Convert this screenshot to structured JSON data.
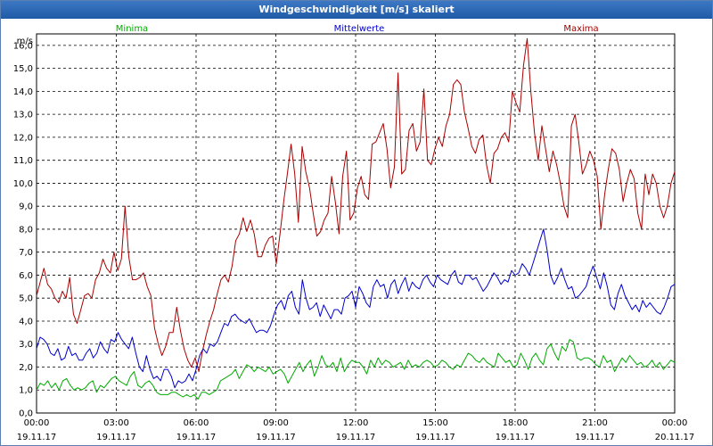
{
  "window": {
    "title": "Windgeschwindigkeit [m/s] skaliert"
  },
  "chart_data": {
    "type": "line",
    "title": "Windgeschwindigkeit [m/s] skaliert",
    "ylabel": "m/s",
    "ylim": [
      0,
      16.5
    ],
    "yticks": [
      0,
      1,
      2,
      3,
      4,
      5,
      6,
      7,
      8,
      9,
      10,
      11,
      12,
      13,
      14,
      15,
      16
    ],
    "ytick_labels": [
      "0,0",
      "1,0",
      "2,0",
      "3,0",
      "4,0",
      "5,0",
      "6,0",
      "7,0",
      "8,0",
      "9,0",
      "10,0",
      "11,0",
      "12,0",
      "13,0",
      "14,0",
      "15,0",
      "16,0"
    ],
    "xlim": [
      0,
      24
    ],
    "xticks": [
      0,
      3,
      6,
      9,
      12,
      15,
      18,
      21,
      24
    ],
    "xtick_time_labels": [
      "00:00",
      "03:00",
      "06:00",
      "09:00",
      "12:00",
      "15:00",
      "18:00",
      "21:00",
      "00:00"
    ],
    "xtick_date_labels": [
      "19.11.17",
      "19.11.17",
      "19.11.17",
      "19.11.17",
      "19.11.17",
      "19.11.17",
      "19.11.17",
      "19.11.17",
      "20.11.17"
    ],
    "grid": true,
    "legend_position": "top",
    "x_step_hours": 0.1667,
    "series": [
      {
        "name": "Minima",
        "color": "#00aa00",
        "values": [
          1.0,
          1.3,
          1.2,
          1.4,
          1.1,
          1.3,
          1.0,
          1.4,
          1.5,
          1.2,
          1.0,
          1.1,
          1.0,
          1.1,
          1.3,
          1.4,
          0.9,
          1.2,
          1.1,
          1.3,
          1.5,
          1.6,
          1.4,
          1.3,
          1.2,
          1.6,
          1.8,
          1.2,
          1.1,
          1.3,
          1.4,
          1.2,
          0.9,
          0.8,
          0.8,
          0.8,
          0.9,
          0.9,
          0.8,
          0.7,
          0.8,
          0.7,
          0.8,
          0.6,
          0.9,
          0.9,
          0.8,
          0.9,
          1.0,
          1.4,
          1.5,
          1.6,
          1.7,
          1.9,
          1.5,
          1.8,
          2.1,
          2.0,
          1.8,
          2.0,
          1.9,
          1.8,
          2.0,
          1.7,
          1.8,
          1.9,
          1.7,
          1.3,
          1.6,
          1.9,
          2.2,
          1.8,
          2.1,
          2.3,
          1.6,
          2.0,
          2.5,
          2.1,
          2.0,
          2.2,
          1.8,
          2.4,
          1.8,
          2.1,
          2.3,
          2.2,
          2.2,
          2.0,
          1.7,
          2.3,
          2.0,
          2.4,
          2.1,
          2.3,
          2.2,
          2.0,
          2.1,
          2.2,
          1.9,
          2.3,
          2.0,
          2.1,
          2.0,
          2.2,
          2.3,
          2.2,
          2.0,
          2.1,
          2.3,
          2.2,
          2.0,
          1.9,
          2.1,
          2.0,
          2.3,
          2.6,
          2.5,
          2.3,
          2.2,
          2.4,
          2.2,
          2.1,
          2.0,
          2.6,
          2.4,
          2.2,
          2.3,
          2.0,
          2.1,
          2.6,
          2.3,
          1.9,
          2.4,
          2.6,
          2.3,
          2.1,
          2.8,
          3.0,
          2.6,
          2.3,
          2.9,
          2.7,
          3.2,
          3.1,
          2.4,
          2.3,
          2.4,
          2.4,
          2.3,
          2.1,
          2.0,
          2.5,
          2.2,
          2.3,
          1.8,
          2.1,
          2.4,
          2.2,
          2.5,
          2.3,
          2.1,
          2.2,
          2.0,
          2.1,
          2.3,
          2.0,
          2.2,
          1.9,
          2.1,
          2.3,
          2.2
        ]
      },
      {
        "name": "Mittelwerte",
        "color": "#0000cc",
        "values": [
          2.8,
          3.3,
          3.2,
          3.0,
          2.6,
          2.5,
          2.8,
          2.3,
          2.4,
          2.9,
          2.5,
          2.6,
          2.3,
          2.3,
          2.6,
          2.8,
          2.4,
          2.6,
          3.1,
          2.8,
          2.6,
          3.2,
          3.1,
          3.5,
          3.2,
          3.0,
          2.8,
          3.3,
          2.6,
          2.0,
          1.8,
          2.5,
          1.9,
          1.5,
          1.6,
          1.4,
          1.9,
          1.9,
          1.6,
          1.1,
          1.4,
          1.3,
          1.4,
          1.7,
          1.4,
          1.9,
          2.5,
          2.8,
          2.6,
          3.0,
          2.9,
          3.1,
          3.5,
          3.9,
          3.8,
          4.2,
          4.3,
          4.1,
          4.0,
          3.9,
          4.1,
          3.8,
          3.5,
          3.6,
          3.6,
          3.5,
          3.8,
          4.3,
          4.7,
          4.9,
          4.5,
          5.1,
          5.3,
          4.6,
          4.3,
          5.8,
          5.0,
          4.5,
          4.6,
          4.8,
          4.2,
          4.7,
          4.4,
          4.1,
          4.5,
          4.5,
          4.3,
          5.0,
          5.1,
          5.3,
          4.6,
          5.5,
          5.2,
          4.8,
          4.6,
          5.5,
          5.8,
          5.5,
          5.6,
          5.0,
          5.6,
          5.8,
          5.2,
          5.6,
          5.9,
          5.3,
          5.7,
          5.5,
          5.4,
          5.8,
          6.0,
          5.7,
          5.5,
          6.0,
          5.8,
          5.7,
          5.6,
          6.0,
          6.2,
          5.7,
          5.6,
          6.0,
          6.0,
          5.8,
          5.9,
          5.6,
          5.3,
          5.5,
          5.8,
          6.1,
          5.9,
          5.6,
          5.8,
          5.7,
          6.2,
          6.0,
          6.1,
          6.5,
          6.3,
          6.0,
          6.5,
          7.0,
          7.5,
          8.0,
          7.1,
          6.0,
          5.6,
          5.9,
          6.3,
          5.8,
          5.4,
          5.5,
          5.0,
          5.1,
          5.3,
          5.5,
          6.0,
          6.4,
          5.9,
          5.4,
          6.1,
          5.5,
          4.7,
          4.5,
          5.2,
          5.6,
          5.1,
          4.8,
          4.5,
          4.7,
          4.4,
          4.9,
          4.6,
          4.8,
          4.6,
          4.4,
          4.3,
          4.6,
          5.0,
          5.5,
          5.6
        ]
      },
      {
        "name": "Maxima",
        "color": "#aa0000",
        "values": [
          5.1,
          5.7,
          6.3,
          5.6,
          5.4,
          5.0,
          4.8,
          5.3,
          5.0,
          5.9,
          4.3,
          3.9,
          4.5,
          5.1,
          5.2,
          5.0,
          5.8,
          6.1,
          6.7,
          6.3,
          6.1,
          7.0,
          6.2,
          6.7,
          9.0,
          6.8,
          5.8,
          5.8,
          5.9,
          6.1,
          5.5,
          5.1,
          3.7,
          3.0,
          2.5,
          2.9,
          3.5,
          3.5,
          4.6,
          3.6,
          2.8,
          2.3,
          2.0,
          2.4,
          1.8,
          2.7,
          3.4,
          4.0,
          4.5,
          5.2,
          5.8,
          6.0,
          5.7,
          6.4,
          7.5,
          7.8,
          8.5,
          7.9,
          8.4,
          7.8,
          6.8,
          6.8,
          7.3,
          7.6,
          7.7,
          6.5,
          7.8,
          9.2,
          10.4,
          11.7,
          10.4,
          8.3,
          11.6,
          10.5,
          9.8,
          8.7,
          7.7,
          7.9,
          8.4,
          8.7,
          10.3,
          9.2,
          7.8,
          10.3,
          11.4,
          8.4,
          8.7,
          9.8,
          10.3,
          9.5,
          9.3,
          11.7,
          11.8,
          12.2,
          12.6,
          11.5,
          9.8,
          10.7,
          14.8,
          10.4,
          10.6,
          12.3,
          12.6,
          11.4,
          11.8,
          14.1,
          11.0,
          10.8,
          11.5,
          12.0,
          11.6,
          12.5,
          13.0,
          14.3,
          14.5,
          14.3,
          13.1,
          12.4,
          11.6,
          11.3,
          11.9,
          12.1,
          10.8,
          10.0,
          11.3,
          11.5,
          12.0,
          12.2,
          11.8,
          14.0,
          13.5,
          13.1,
          15.1,
          16.3,
          14.0,
          12.2,
          11.0,
          12.5,
          11.5,
          10.5,
          11.4,
          10.8,
          10.0,
          9.0,
          8.5,
          12.5,
          13.0,
          11.8,
          10.4,
          10.8,
          11.4,
          11.0,
          10.3,
          8.0,
          9.5,
          10.6,
          11.5,
          11.3,
          10.6,
          9.2,
          10.0,
          10.6,
          10.2,
          8.7,
          8.0,
          10.4,
          9.5,
          10.4,
          10.0,
          9.0,
          8.5,
          9.0,
          10.0,
          10.5
        ]
      }
    ]
  }
}
